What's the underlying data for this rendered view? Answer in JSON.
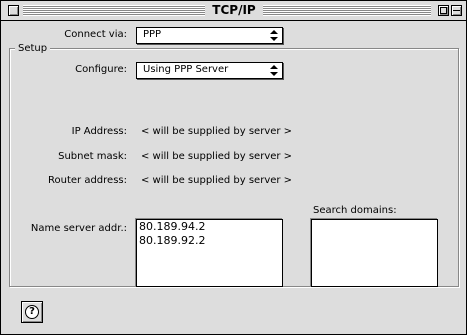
{
  "window": {
    "title": "TCP/IP"
  },
  "connect_via": {
    "label": "Connect via:",
    "value": "PPP"
  },
  "setup": {
    "title": "Setup",
    "configure": {
      "label": "Configure:",
      "value": "Using PPP Server"
    },
    "ip_address": {
      "label": "IP Address:",
      "value": "< will be supplied by server >"
    },
    "subnet_mask": {
      "label": "Subnet mask:",
      "value": "< will be supplied by server >"
    },
    "router_address": {
      "label": "Router address:",
      "value": "< will be supplied by server >"
    },
    "name_server": {
      "label": "Name server addr.:",
      "entries": [
        "80.189.94.2",
        "80.189.92.2"
      ]
    },
    "search_domains": {
      "label": "Search domains:",
      "entries": []
    }
  },
  "help": {
    "icon": "help-icon",
    "glyph": "?"
  }
}
